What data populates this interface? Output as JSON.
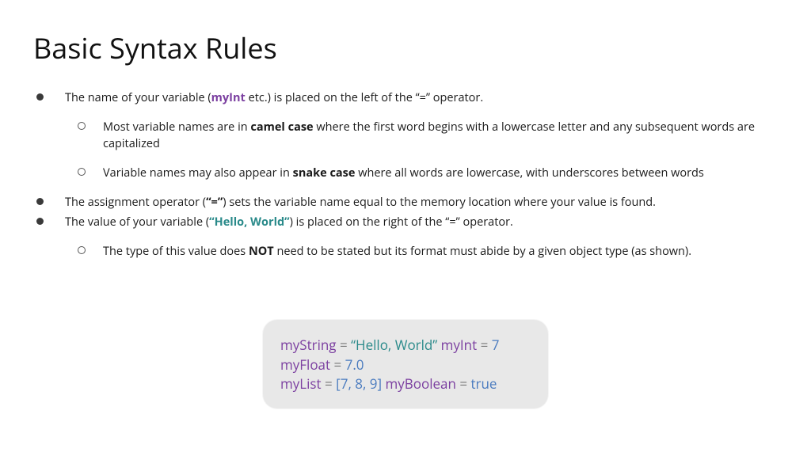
{
  "title": "Basic Syntax Rules",
  "bullets": {
    "b1_pre": "The name of your variable (",
    "b1_var": "myInt",
    "b1_post": " etc.) is placed on the left of the “=” operator.",
    "b1_sub1_pre": "Most variable names are in ",
    "b1_sub1_bold": "camel case",
    "b1_sub1_post": " where the first word begins with a lowercase letter and any subsequent words are capitalized",
    "b1_sub2_pre": "Variable names may also appear in ",
    "b1_sub2_bold": "snake case",
    "b1_sub2_post": " where all words are lowercase, with underscores between words",
    "b2_pre": "The assignment operator (",
    "b2_bold": "“=”",
    "b2_post": ") sets the variable name equal to the memory location where your value is found.",
    "b3_pre": "The value of your variable (",
    "b3_val": "“Hello, World”",
    "b3_post": ") is placed on the right of the “=” operator.",
    "b3_sub1_pre": "The type of this value does ",
    "b3_sub1_bold": "NOT",
    "b3_sub1_post": " need to be stated but its format must abide by a given object type (as shown)."
  },
  "code": {
    "l1": {
      "v1": "myString",
      "eq": " = ",
      "s1": "“Hello, World”",
      "sp": " ",
      "v2": "myInt",
      "n1": "7"
    },
    "l2": {
      "v1": "myFloat",
      "eq": " = ",
      "n1": "7.0"
    },
    "l3": {
      "v1": "myList",
      "eq": " = ",
      "arr": "[7, 8, 9]",
      "sp": " ",
      "v2": "myBoolean",
      "b1": "true"
    }
  }
}
